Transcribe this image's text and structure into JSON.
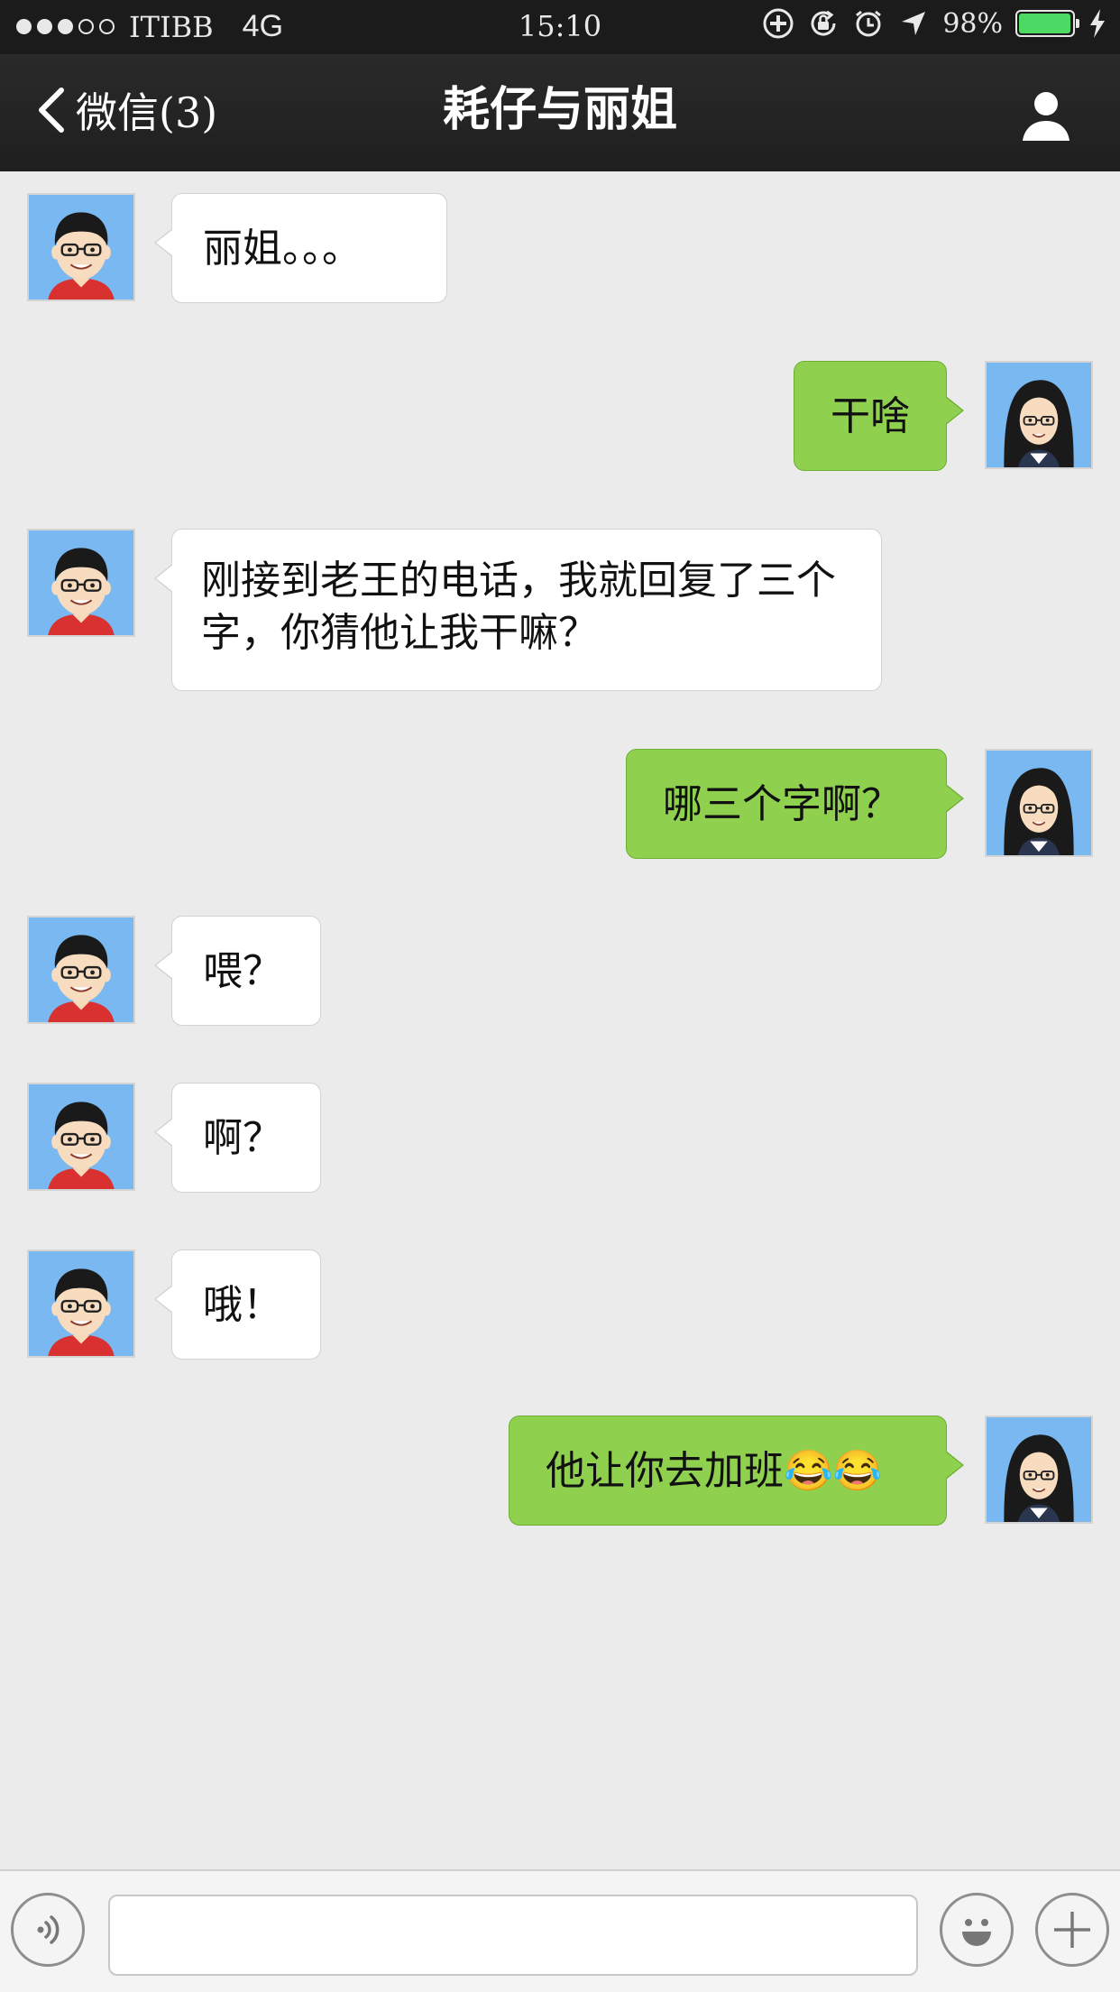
{
  "status_bar": {
    "signal_dots_filled": 3,
    "signal_dots_total": 5,
    "carrier": "ITIBB",
    "network": "4G",
    "time": "15:10",
    "battery_percent": "98%",
    "battery_level": 0.98,
    "battery_color": "#4cd964",
    "icons": [
      "add-circle-icon",
      "rotation-lock-icon",
      "alarm-icon",
      "location-arrow-icon",
      "charging-bolt-icon"
    ]
  },
  "nav": {
    "back_label": "微信(3)",
    "title": "耗仔与丽姐",
    "right_icon": "profile-icon"
  },
  "messages": [
    {
      "side": "in",
      "text": "丽姐。。。"
    },
    {
      "side": "out",
      "text": "干啥"
    },
    {
      "side": "in",
      "text": "刚接到老王的电话，我就回复了三个字，你猜他让我干嘛？"
    },
    {
      "side": "out",
      "text": "哪三个字啊？"
    },
    {
      "side": "in",
      "text": "喂？"
    },
    {
      "side": "in",
      "text": "啊？"
    },
    {
      "side": "in",
      "text": "哦！"
    },
    {
      "side": "out",
      "text": "他让你去加班😂😂"
    }
  ],
  "colors": {
    "background": "#ebebeb",
    "outgoing_bubble": "#8fd14f",
    "incoming_bubble": "#ffffff",
    "nav_bar": "#222222"
  },
  "input_bar": {
    "voice_icon": "voice-icon",
    "text_value": "",
    "emoji_icon": "emoji-icon",
    "plus_icon": "plus-icon"
  }
}
